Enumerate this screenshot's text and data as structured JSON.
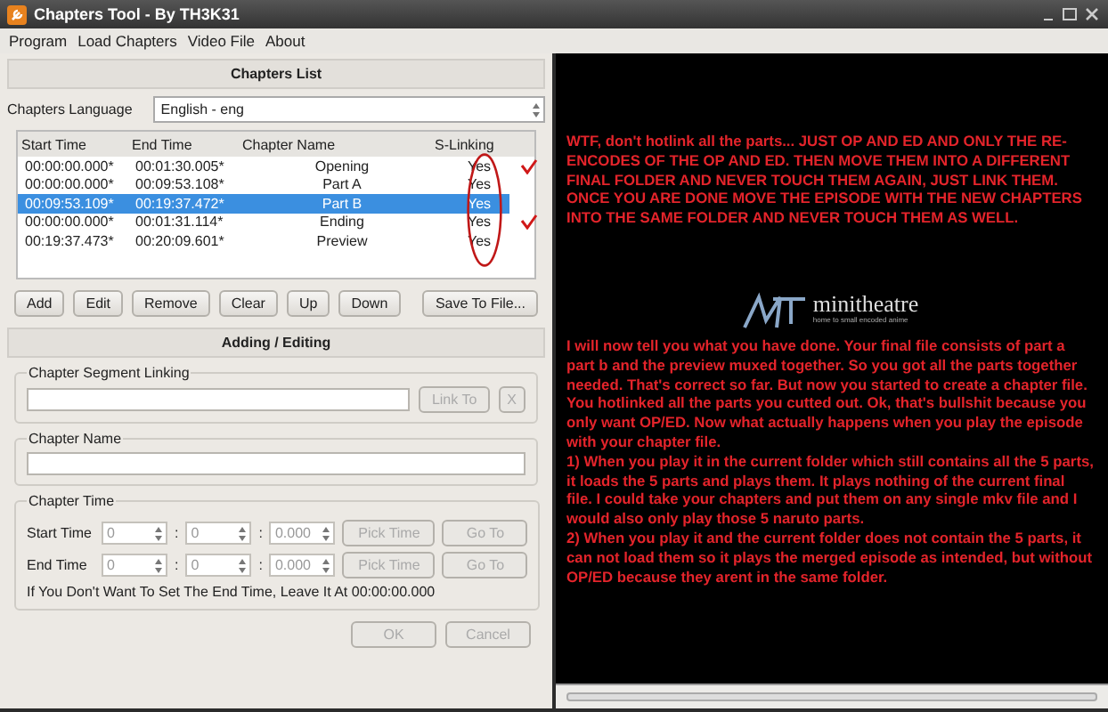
{
  "window": {
    "title": "Chapters Tool - By TH3K31"
  },
  "menu": [
    "Program",
    "Load Chapters",
    "Video File",
    "About"
  ],
  "chapters_list": {
    "title": "Chapters List",
    "language_label": "Chapters Language",
    "language_value": "English - eng",
    "columns": [
      "Start Time",
      "End Time",
      "Chapter Name",
      "S-Linking"
    ],
    "rows": [
      {
        "start": "00:00:00.000*",
        "end": "00:01:30.005*",
        "name": "Opening",
        "linking": "Yes",
        "selected": false,
        "tick": true
      },
      {
        "start": "00:00:00.000*",
        "end": "00:09:53.108*",
        "name": "Part A",
        "linking": "Yes",
        "selected": false,
        "tick": false
      },
      {
        "start": "00:09:53.109*",
        "end": "00:19:37.472*",
        "name": "Part B",
        "linking": "Yes",
        "selected": true,
        "tick": false
      },
      {
        "start": "00:00:00.000*",
        "end": "00:01:31.114*",
        "name": "Ending",
        "linking": "Yes",
        "selected": false,
        "tick": true
      },
      {
        "start": "00:19:37.473*",
        "end": "00:20:09.601*",
        "name": "Preview",
        "linking": "Yes",
        "selected": false,
        "tick": false
      }
    ],
    "buttons": [
      "Add",
      "Edit",
      "Remove",
      "Clear",
      "Up",
      "Down",
      "Save To File..."
    ]
  },
  "adding_editing": {
    "title": "Adding / Editing",
    "segment_linking": {
      "label": "Chapter Segment Linking",
      "link_button": "Link To",
      "clear_button": "X"
    },
    "chapter_name": {
      "label": "Chapter Name"
    },
    "chapter_time": {
      "label": "Chapter Time",
      "rows": [
        {
          "label": "Start Time",
          "hours": "0",
          "minutes": "0",
          "seconds": "0.000",
          "pick": "Pick Time",
          "goto": "Go To"
        },
        {
          "label": "End Time",
          "hours": "0",
          "minutes": "0",
          "seconds": "0.000",
          "pick": "Pick Time",
          "goto": "Go To"
        }
      ],
      "separator": ":",
      "hint": "If You Don't Want To Set The End Time, Leave It At 00:00:00.000"
    },
    "ok": "OK",
    "cancel": "Cancel"
  },
  "video": {
    "logo": "minitheatre",
    "tagline": "home to small encoded anime",
    "notes": [
      "WTF, don't hotlink all the parts... JUST OP AND ED AND ONLY THE RE-ENCODES OF THE OP AND ED. THEN MOVE THEM INTO A DIFFERENT FINAL FOLDER AND NEVER TOUCH THEM AGAIN, JUST LINK THEM. ONCE YOU ARE DONE MOVE THE EPISODE WITH THE NEW CHAPTERS INTO THE SAME FOLDER AND NEVER TOUCH THEM AS WELL.",
      "I will now tell you what you have done. Your final file consists of part a part b and the preview muxed together. So you got all the parts together needed. That's correct so far. But now you started to create a chapter file. You hotlinked all the parts you cutted out. Ok, that's bullshit because you only want OP/ED. Now what actually happens when you play the episode with your chapter file.",
      "1) When you play it in the current folder which still contains all the 5 parts, it loads the 5 parts and plays them. It plays nothing of the current final file. I could take your chapters and put them on any single mkv file and I would also only play those 5 naruto parts.",
      "2) When you play it and the current folder does not contain the 5 parts, it can not load them so it plays the merged episode as intended, but without OP/ED because they arent in the same folder."
    ]
  }
}
